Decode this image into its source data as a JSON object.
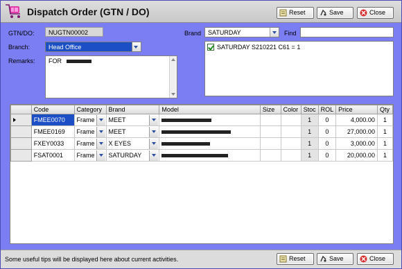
{
  "window": {
    "title": "Dispatch Order (GTN / DO)"
  },
  "toolbar": {
    "reset_label": "Reset",
    "save_label": "Save",
    "close_label": "Close"
  },
  "form": {
    "gtn_label": "GTN/DO:",
    "gtn_value": "NUGTN00002",
    "branch_label": "Branch:",
    "branch_value": "Head Office",
    "remarks_label": "Remarks:",
    "remarks_value": "FOR",
    "brand_label": "Brand",
    "brand_value": "SATURDAY",
    "find_label": "Find",
    "find_value": "",
    "brand_list": [
      {
        "label": "SATURDAY S210221 C61  = 1",
        "checked": true
      }
    ]
  },
  "grid": {
    "columns": [
      "",
      "Code",
      "Category",
      "Brand",
      "Model",
      "Size",
      "Color",
      "Stoc",
      "ROL",
      "Price",
      "Qty"
    ],
    "rows": [
      {
        "code": "FMEE0070",
        "category": "Frame",
        "brand": "MEET",
        "size": "",
        "color": "",
        "stock": "1",
        "rol": "0",
        "price": "4,000.00",
        "qty": "1"
      },
      {
        "code": "FMEE0169",
        "category": "Frame",
        "brand": "MEET",
        "size": "",
        "color": "",
        "stock": "1",
        "rol": "0",
        "price": "27,000.00",
        "qty": "1"
      },
      {
        "code": "FXEY0033",
        "category": "Frame",
        "brand": "X EYES",
        "size": "",
        "color": "",
        "stock": "1",
        "rol": "0",
        "price": "3,000.00",
        "qty": "1"
      },
      {
        "code": "FSAT0001",
        "category": "Frame",
        "brand": "SATURDAY",
        "size": "",
        "color": "",
        "stock": "1",
        "rol": "0",
        "price": "20,000.00",
        "qty": "1"
      }
    ]
  },
  "status": {
    "tip": "Some useful tips will be displayed here about current activities."
  },
  "icons": {
    "app": "shopping-cart-icon",
    "reset": "reset-icon",
    "save": "save-icon",
    "close": "close-icon"
  },
  "colors": {
    "background": "#7b7ef2",
    "selection": "#1c4fc4",
    "title_bar": "#d4d4d4"
  }
}
